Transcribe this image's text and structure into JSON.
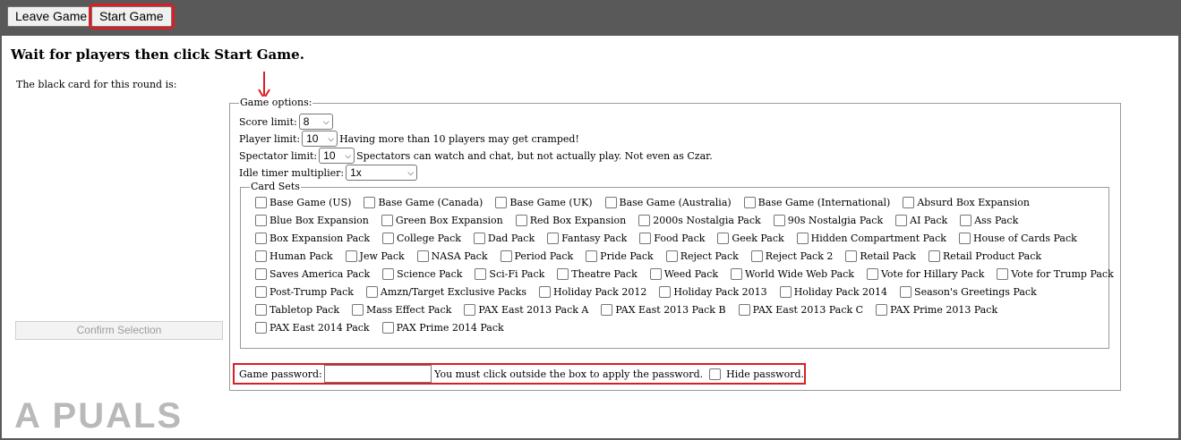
{
  "toolbar": {
    "leave_label": "Leave Game",
    "start_label": "Start Game"
  },
  "page": {
    "title": "Wait for players then click Start Game.",
    "black_card_label": "The black card for this round is:",
    "confirm_label": "Confirm Selection"
  },
  "options": {
    "legend": "Game options:",
    "score_label": "Score limit:",
    "score_value": "8",
    "player_label": "Player limit:",
    "player_value": "10",
    "player_note": "Having more than 10 players may get cramped!",
    "spectator_label": "Spectator limit:",
    "spectator_value": "10",
    "spectator_note": "Spectators can watch and chat, but not actually play. Not even as Czar.",
    "idle_label": "Idle timer multiplier:",
    "idle_value": "1x"
  },
  "card_sets": {
    "legend": "Card Sets",
    "rows": [
      [
        "Base Game (US)",
        "Base Game (Canada)",
        "Base Game (UK)",
        "Base Game (Australia)",
        "Base Game (International)",
        "Absurd Box Expansion"
      ],
      [
        "Blue Box Expansion",
        "Green Box Expansion",
        "Red Box Expansion",
        "2000s Nostalgia Pack",
        "90s Nostalgia Pack",
        "AI Pack",
        "Ass Pack"
      ],
      [
        "Box Expansion Pack",
        "College Pack",
        "Dad Pack",
        "Fantasy Pack",
        "Food Pack",
        "Geek Pack",
        "Hidden Compartment Pack",
        "House of Cards Pack"
      ],
      [
        "Human Pack",
        "Jew Pack",
        "NASA Pack",
        "Period Pack",
        "Pride Pack",
        "Reject Pack",
        "Reject Pack 2",
        "Retail Pack",
        "Retail Product Pack"
      ],
      [
        "Saves America Pack",
        "Science Pack",
        "Sci-Fi Pack",
        "Theatre Pack",
        "Weed Pack",
        "World Wide Web Pack",
        "Vote for Hillary Pack",
        "Vote for Trump Pack"
      ],
      [
        "Post-Trump Pack",
        "Amzn/Target Exclusive Packs",
        "Holiday Pack 2012",
        "Holiday Pack 2013",
        "Holiday Pack 2014",
        "Season's Greetings Pack"
      ],
      [
        "Tabletop Pack",
        "Mass Effect Pack",
        "PAX East 2013 Pack A",
        "PAX East 2013 Pack B",
        "PAX East 2013 Pack C",
        "PAX Prime 2013 Pack"
      ],
      [
        "PAX East 2014 Pack",
        "PAX Prime 2014 Pack"
      ]
    ]
  },
  "password": {
    "label": "Game password:",
    "value": "",
    "note": "You must click outside the box to apply the password.",
    "hide_label": "Hide password."
  },
  "watermark": {
    "text": "A  PUALS"
  },
  "colors": {
    "highlight": "#d81f26",
    "toolbar_bg": "#595959"
  }
}
